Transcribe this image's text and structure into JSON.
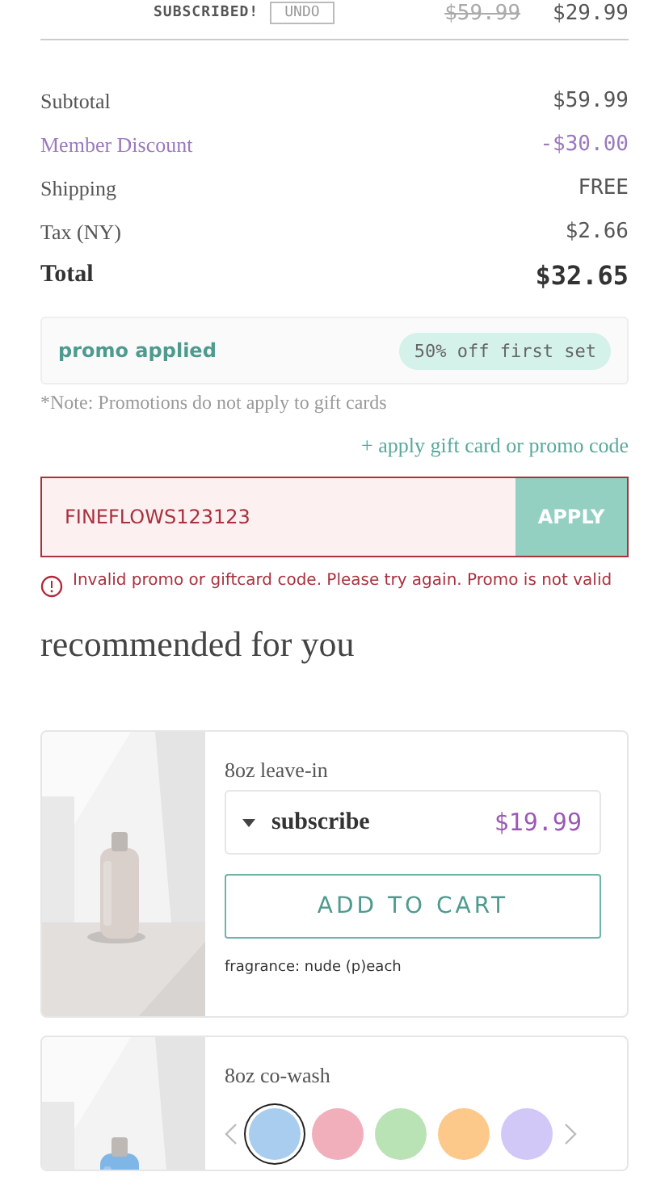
{
  "cart_item": {
    "status": "SUBSCRIBED!",
    "undo": "UNDO",
    "original_price": "$59.99",
    "price": "$29.99"
  },
  "summary": [
    {
      "label": "Subtotal",
      "value": "$59.99",
      "kind": "normal"
    },
    {
      "label": "Member Discount",
      "value": "-$30.00",
      "kind": "discount"
    },
    {
      "label": "Shipping",
      "value": "FREE",
      "kind": "normal"
    },
    {
      "label": "Tax (NY)",
      "value": "$2.66",
      "kind": "normal"
    },
    {
      "label": "Total",
      "value": "$32.65",
      "kind": "total"
    }
  ],
  "promo": {
    "label": "promo applied",
    "badge": "50% off first set"
  },
  "note": "*Note: Promotions do not apply to gift cards",
  "promo_link": "+ apply gift card or promo code",
  "code_input": {
    "value": "FINEFLOWS123123",
    "error": true,
    "button": "APPLY"
  },
  "error_message": "Invalid promo or giftcard code. Please try again. Promo is not valid",
  "recommended": {
    "title": "recommended for you",
    "products": [
      {
        "kind": "subscribe",
        "name": "8oz leave-in",
        "option": "subscribe",
        "price": "$19.99",
        "button": "ADD TO CART",
        "fragrance": "fragrance: nude (p)each"
      },
      {
        "kind": "swatches",
        "name": "8oz co-wash",
        "swatches": [
          {
            "color": "#a9cdee",
            "selected": true
          },
          {
            "color": "#f0afbb",
            "selected": false
          },
          {
            "color": "#b9e3b4",
            "selected": false
          },
          {
            "color": "#fcc98a",
            "selected": false
          },
          {
            "color": "#d2c8f8",
            "selected": false
          }
        ]
      }
    ]
  }
}
